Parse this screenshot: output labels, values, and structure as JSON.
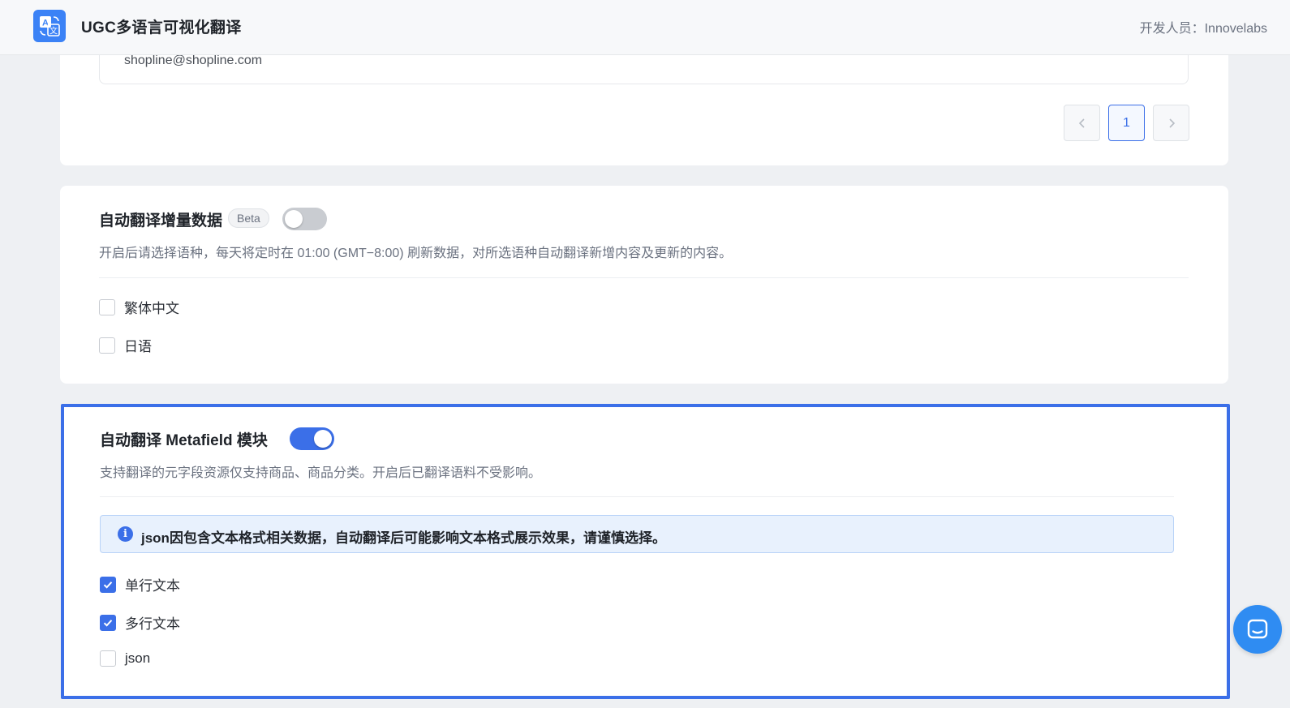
{
  "header": {
    "app_title": "UGC多语言可视化翻译",
    "developer": "开发人员：Innovelabs",
    "logo_icon": "translate-icon"
  },
  "top_card": {
    "email": "shopline@shopline.com",
    "pagination": {
      "prev_icon": "chevron-left-icon",
      "current_page": "1",
      "next_icon": "chevron-right-icon"
    }
  },
  "incremental": {
    "title": "自动翻译增量数据",
    "badge": "Beta",
    "toggle_on": false,
    "description": "开启后请选择语种，每天将定时在 01:00 (GMT−8:00) 刷新数据，对所选语种自动翻译新增内容及更新的内容。",
    "languages": [
      {
        "label": "繁体中文",
        "checked": false
      },
      {
        "label": "日语",
        "checked": false
      }
    ]
  },
  "metafield": {
    "title": "自动翻译 Metafield 模块",
    "toggle_on": true,
    "description": "支持翻译的元字段资源仅支持商品、商品分类。开启后已翻译语料不受影响。",
    "alert_icon": "info-icon",
    "alert": "json因包含文本格式相关数据，自动翻译后可能影响文本格式展示效果，请谨慎选择。",
    "types": [
      {
        "label": "单行文本",
        "checked": true
      },
      {
        "label": "多行文本",
        "checked": true
      },
      {
        "label": "json",
        "checked": false
      }
    ]
  },
  "chat": {
    "icon": "chat-icon"
  },
  "colors": {
    "accent": "#3b6fe8",
    "alert_bg": "#e8f1fd",
    "chat": "#2f8cf2"
  }
}
